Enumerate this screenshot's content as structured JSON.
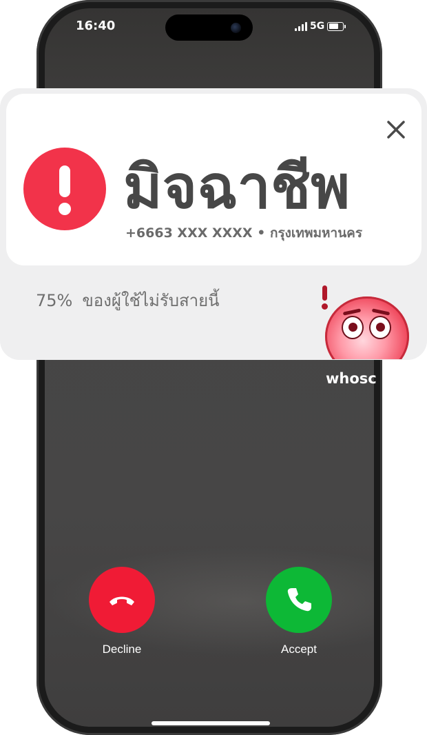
{
  "status_bar": {
    "time": "16:40",
    "network": "5G",
    "battery_icon": "battery-icon",
    "signal_icon": "signal-bars-icon"
  },
  "alert": {
    "title": "มิจฉาชีพ",
    "meta": "+6663 XXX XXXX • กรุงเทพมหานคร",
    "stat_percent": "75%",
    "stat_text": "ของผู้ใช้ไม่รับสายนี้",
    "close_icon": "close-icon",
    "warning_icon": "exclamation-circle-icon",
    "accent_color": "#f2334a"
  },
  "brand": {
    "name": "whoscall",
    "visible_text": "whosc",
    "mascot_icon": "alarmed-face-mascot-icon"
  },
  "call_actions": {
    "decline_label": "Decline",
    "accept_label": "Accept",
    "decline_color": "#f01b35",
    "accept_color": "#0db836",
    "decline_icon": "hang-up-phone-icon",
    "accept_icon": "phone-icon"
  }
}
